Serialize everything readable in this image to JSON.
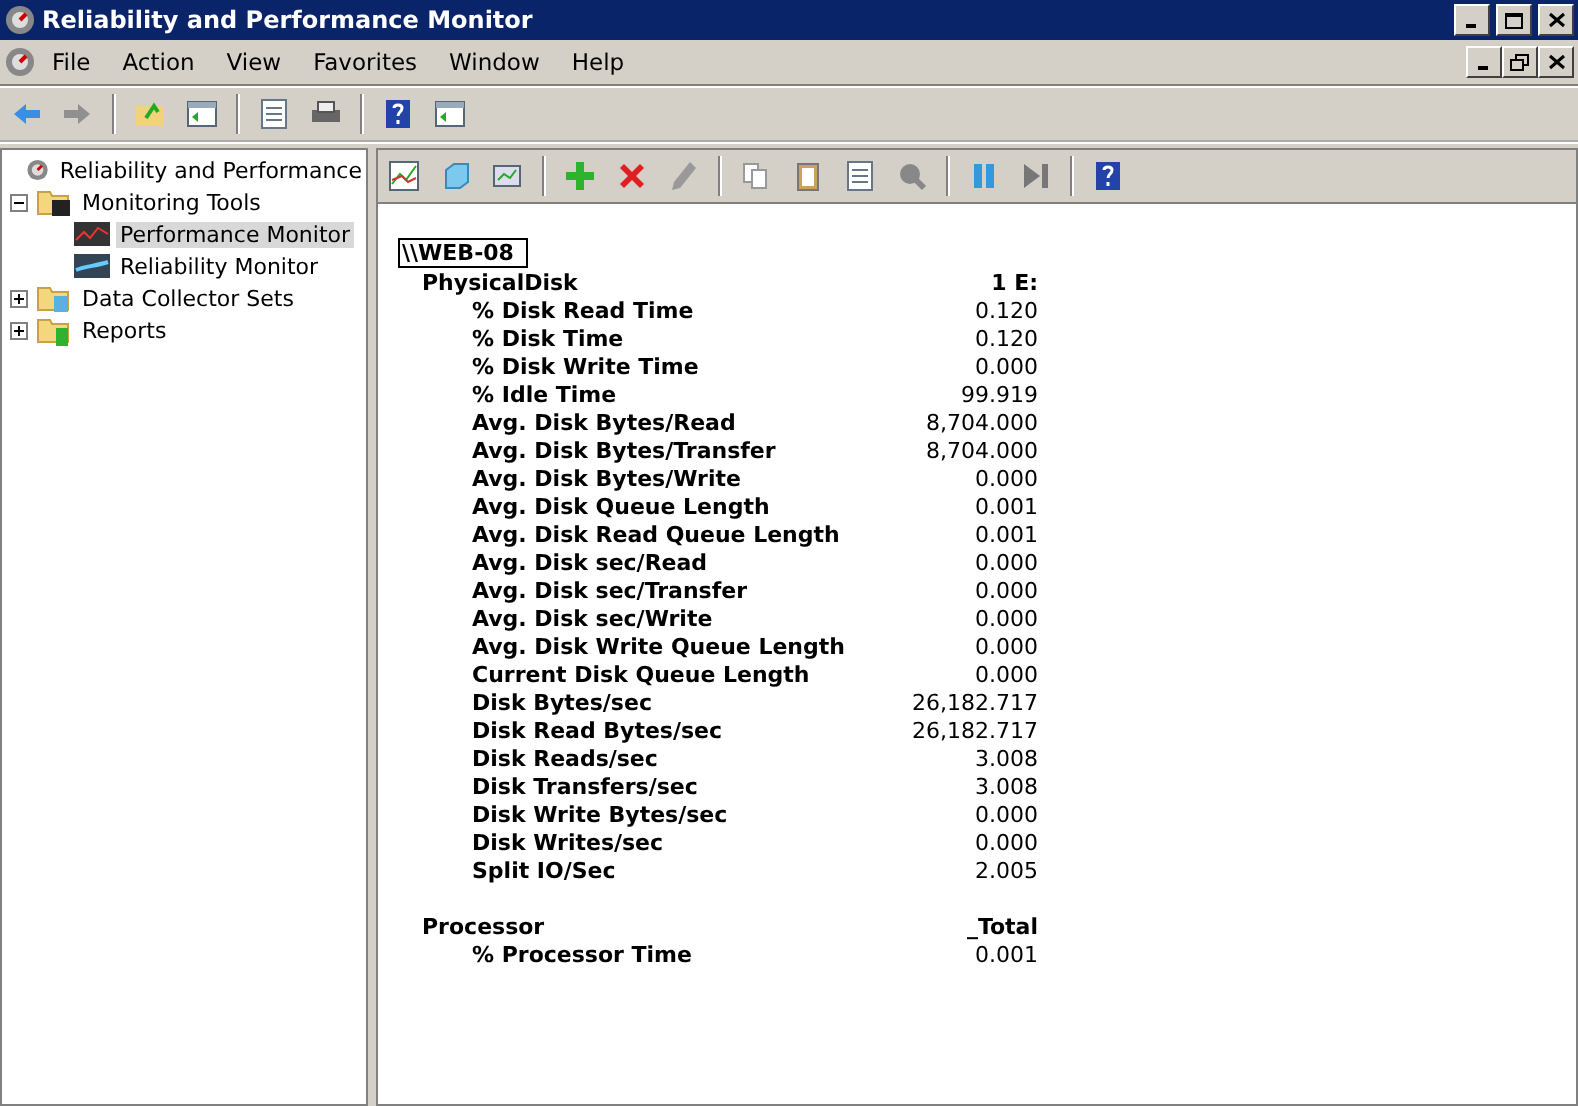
{
  "window": {
    "title": "Reliability and Performance Monitor"
  },
  "menu": [
    "File",
    "Action",
    "View",
    "Favorites",
    "Window",
    "Help"
  ],
  "tree": [
    {
      "label": "Reliability and Performance",
      "selected": false,
      "children": [
        {
          "label": "Monitoring Tools",
          "expanded": true,
          "selected": false,
          "children": [
            {
              "label": "Performance Monitor",
              "selected": true
            },
            {
              "label": "Reliability Monitor",
              "selected": false
            }
          ]
        },
        {
          "label": "Data Collector Sets",
          "expanded": false,
          "selected": false
        },
        {
          "label": "Reports",
          "expanded": false,
          "selected": false
        }
      ]
    }
  ],
  "report": {
    "computer": "\\\\WEB-08",
    "objects": [
      {
        "name": "PhysicalDisk",
        "instance": "1 E:",
        "counters": [
          {
            "name": "% Disk Read Time",
            "value": "0.120"
          },
          {
            "name": "% Disk Time",
            "value": "0.120"
          },
          {
            "name": "% Disk Write Time",
            "value": "0.000"
          },
          {
            "name": "% Idle Time",
            "value": "99.919"
          },
          {
            "name": "Avg. Disk Bytes/Read",
            "value": "8,704.000"
          },
          {
            "name": "Avg. Disk Bytes/Transfer",
            "value": "8,704.000"
          },
          {
            "name": "Avg. Disk Bytes/Write",
            "value": "0.000"
          },
          {
            "name": "Avg. Disk Queue Length",
            "value": "0.001"
          },
          {
            "name": "Avg. Disk Read Queue Length",
            "value": "0.001"
          },
          {
            "name": "Avg. Disk sec/Read",
            "value": "0.000"
          },
          {
            "name": "Avg. Disk sec/Transfer",
            "value": "0.000"
          },
          {
            "name": "Avg. Disk sec/Write",
            "value": "0.000"
          },
          {
            "name": "Avg. Disk Write Queue Length",
            "value": "0.000"
          },
          {
            "name": "Current Disk Queue Length",
            "value": "0.000"
          },
          {
            "name": "Disk Bytes/sec",
            "value": "26,182.717"
          },
          {
            "name": "Disk Read Bytes/sec",
            "value": "26,182.717"
          },
          {
            "name": "Disk Reads/sec",
            "value": "3.008"
          },
          {
            "name": "Disk Transfers/sec",
            "value": "3.008"
          },
          {
            "name": "Disk Write Bytes/sec",
            "value": "0.000"
          },
          {
            "name": "Disk Writes/sec",
            "value": "0.000"
          },
          {
            "name": "Split IO/Sec",
            "value": "2.005"
          }
        ]
      },
      {
        "name": "Processor",
        "instance": "_Total",
        "counters": [
          {
            "name": "% Processor Time",
            "value": "0.001"
          }
        ]
      }
    ]
  }
}
